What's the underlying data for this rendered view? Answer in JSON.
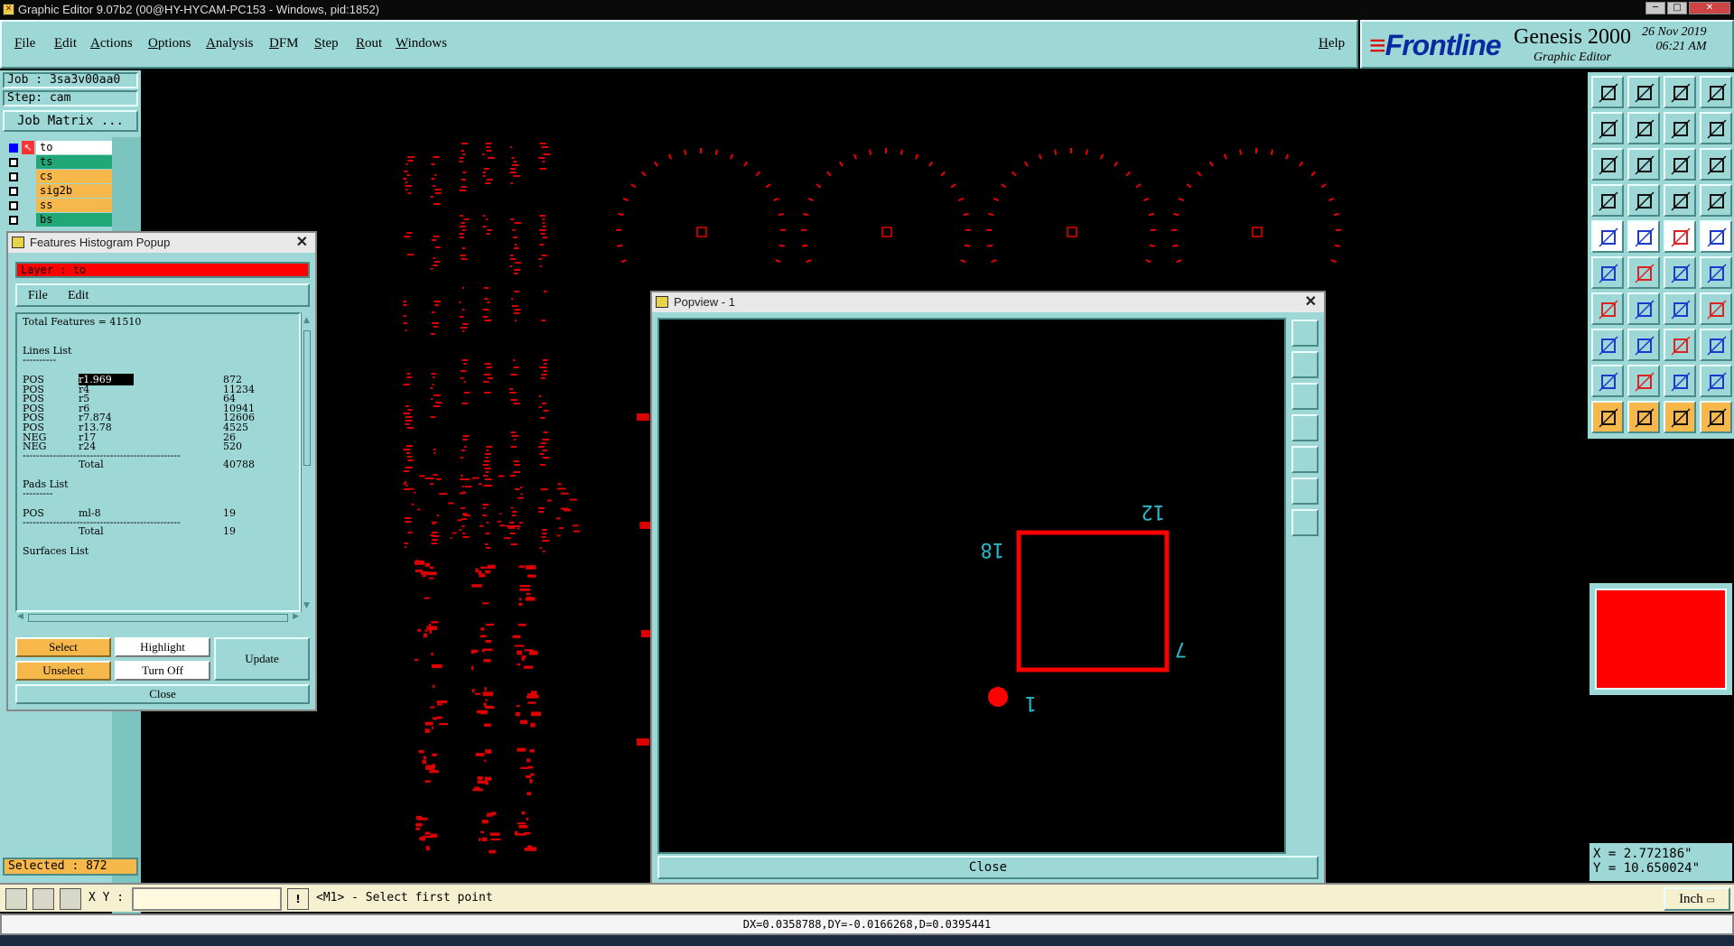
{
  "window": {
    "title": "Graphic Editor 9.07b2 (00@HY-HYCAM-PC153 - Windows, pid:1852)"
  },
  "menu": {
    "items": [
      "File",
      "Edit",
      "Actions",
      "Options",
      "Analysis",
      "DFM",
      "Step",
      "Rout",
      "Windows"
    ],
    "help": "Help"
  },
  "logo": {
    "brand": "Frontline",
    "product": "Genesis 2000",
    "subtitle": "Graphic Editor",
    "date": "26 Nov 2019",
    "time": "06:21 AM"
  },
  "left": {
    "job": "Job : 3sa3v00aa0",
    "step": "Step: cam",
    "job_matrix": "Job Matrix ...",
    "layers": [
      {
        "name": "to",
        "color": "#ffffff"
      },
      {
        "name": "ts",
        "color": "#22a878"
      },
      {
        "name": "cs",
        "color": "#f6b84a"
      },
      {
        "name": "sig2b",
        "color": "#f6b84a"
      },
      {
        "name": "ss",
        "color": "#f6b84a"
      },
      {
        "name": "bs",
        "color": "#22a878"
      }
    ],
    "selected": "Selected : 872"
  },
  "histogram": {
    "title": "Features Histogram Popup",
    "layer": "Layer :  to",
    "menu": [
      "File",
      "Edit"
    ],
    "total_features": "Total Features = 41510",
    "lines_header": "Lines List",
    "lines_rule": "----------",
    "lines": [
      {
        "pol": "POS",
        "sym": "r1.969",
        "count": "872"
      },
      {
        "pol": "POS",
        "sym": "r4",
        "count": "11234"
      },
      {
        "pol": "POS",
        "sym": "r5",
        "count": "64"
      },
      {
        "pol": "POS",
        "sym": "r6",
        "count": "10941"
      },
      {
        "pol": "POS",
        "sym": "r7.874",
        "count": "12606"
      },
      {
        "pol": "POS",
        "sym": "r13.78",
        "count": "4525"
      },
      {
        "pol": "NEG",
        "sym": "r17",
        "count": "26"
      },
      {
        "pol": "NEG",
        "sym": "r24",
        "count": "520"
      }
    ],
    "rule": "-----------------------------------------------",
    "lines_total_label": "Total",
    "lines_total": "40788",
    "pads_header": "Pads List",
    "pads_rule": "---------",
    "pads": [
      {
        "pol": "POS",
        "sym": "ml-8",
        "count": "19"
      }
    ],
    "pads_total_label": "Total",
    "pads_total": "19",
    "surfaces_header": "Surfaces List",
    "buttons": {
      "select": "Select",
      "highlight": "Highlight",
      "update": "Update",
      "unselect": "Unselect",
      "turnoff": "Turn Off",
      "close": "Close"
    }
  },
  "popview": {
    "title": "Popview - 1",
    "pin_labels": [
      "12",
      "18",
      "7",
      "1"
    ],
    "close": "Close"
  },
  "coords": {
    "x": "X = 2.772186\"",
    "y": "Y = 10.650024\""
  },
  "cmd": {
    "xy_label": "X Y :",
    "xy_value": "",
    "prompt": "<M1> - Select first point",
    "unit": "Inch"
  },
  "status": {
    "dx": "DX=0.0358788,DY=-0.0166268,D=0.0395441"
  },
  "colors": {
    "panel": "#9ed8d6",
    "feature": "#ff0000",
    "highlight_button": "#f6b84a"
  }
}
